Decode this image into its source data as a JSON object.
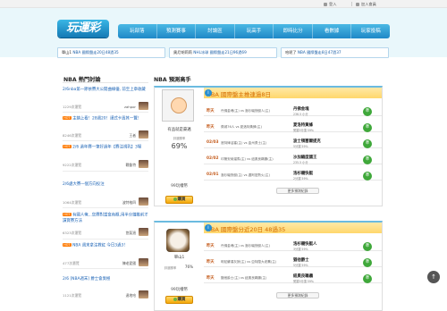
{
  "topbar": {
    "login": "登入",
    "register": "加入會員"
  },
  "logo": "玩運彩",
  "nav": [
    "玩部落",
    "預測賽事",
    "討論區",
    "玩高手",
    "即時比分",
    "看數據",
    "玩家投稿"
  ],
  "banners": [
    {
      "user": "單山1",
      "text": "NBA 國際盤走20日48過35"
    },
    {
      "user": "奧尼胡莉莉",
      "text": "NHL冰球 國際盤走21日96過69"
    },
    {
      "user": "哈呢了",
      "text": "NBA 國際盤走8日47過37"
    }
  ],
  "left": {
    "title": "NBA 熱門討論",
    "items": [
      {
        "title": "2/6nba第一節依賽大公開曲線優, 前至上章收藏",
        "hot": "",
        "meta": "1229次瀏覽",
        "user": "zahpor"
      },
      {
        "title": "主鎮上看！28週20！謹式卡貢其一覽！",
        "hot": "HOT",
        "meta": "8246次瀏覽",
        "user": "王者"
      },
      {
        "title": "2/6 過年賽一筆好過年【賽注視乳】3場",
        "hot": "HOT",
        "meta": "9222次瀏覽",
        "user": "戰魯特"
      },
      {
        "title": "2/6處大賽一個方向投注",
        "hot": "",
        "meta": "1064次瀏覽",
        "user": "波特格四"
      },
      {
        "title": "有國人俺...您賽對當盒色概,用半分鐘推前才讀寶賽方法",
        "hot": "HOT",
        "meta": "6323次瀏覽",
        "user": "悠斐過"
      },
      {
        "title": "NBA 週末拿注教紅 今日3過3！",
        "hot": "HOT",
        "meta": "477次瀏覽",
        "user": "陳老愛國"
      },
      {
        "title": "2/6 [NBA週末] 爵士會臭極",
        "hot": "",
        "meta": "1121次瀏覽",
        "user": "達地哈"
      }
    ]
  },
  "main": {
    "title": "NBA 預測高手",
    "cards": [
      {
        "title": "NBA 國際盤主推連過8日",
        "name": "有品就是豪邁",
        "rate_label": "評選勝率",
        "rate": "69%",
        "price": "99玩權幣",
        "buy": "購買",
        "more": "更多預測紀錄",
        "rows": [
          {
            "date": "昨天",
            "match": "丹佛金塊(主) vs 洛杉磯快艇人(主)",
            "pick": "丹佛金塊",
            "sub": "236.5 小分",
            "btn": "準"
          },
          {
            "date": "昨天",
            "match": "費城76人 vs 夏洛特黃蜂(主)",
            "pick": "夏洛特黃蜂",
            "sub": "受讓3分讓 59%",
            "btn": "準"
          },
          {
            "date": "02/03",
            "match": "底特律活塞(主) vs 金州勇士(主)",
            "pick": "波士頓塞爾提克",
            "sub": "5分讓 59%",
            "btn": "準"
          },
          {
            "date": "02/02",
            "match": "印第安納溜馬(主) vs 紐奧良鵜鶘(主)",
            "pick": "沙加緬度國王",
            "sub": "235.5 小分",
            "btn": "準"
          },
          {
            "date": "02/01",
            "match": "洛杉磯快艇(主) vs 邁阿密熱火(主)",
            "pick": "洛杉磯快艇",
            "sub": "2分讓 59%",
            "btn": "準"
          }
        ]
      },
      {
        "title": "NBA 國際盤分近20日 48過35",
        "name": "單山1",
        "rate_label": "評選勝率",
        "rate": "76%",
        "price": "99玩權幣",
        "buy": "購買",
        "more": "更多預測紀錄",
        "rows": [
          {
            "date": "昨天",
            "match": "丹佛金塊(主) vs 洛杉磯快艇人(主)",
            "pick": "洛杉磯快艇人",
            "sub": "3分讓 59%",
            "btn": "準"
          },
          {
            "date": "昨天",
            "match": "明尼蘇達灰狼(主) vs 亞特蘭大老鷹(主)",
            "pick": "猶他爵士",
            "sub": "5分讓 59%",
            "btn": "準"
          },
          {
            "date": "昨天",
            "match": "猶他爵士(主) vs 紐奧良鵜鶘(主)",
            "pick": "紐奧良鵜鶘",
            "sub": "受讓3分讓 59%",
            "btn": "準"
          }
        ]
      }
    ]
  }
}
